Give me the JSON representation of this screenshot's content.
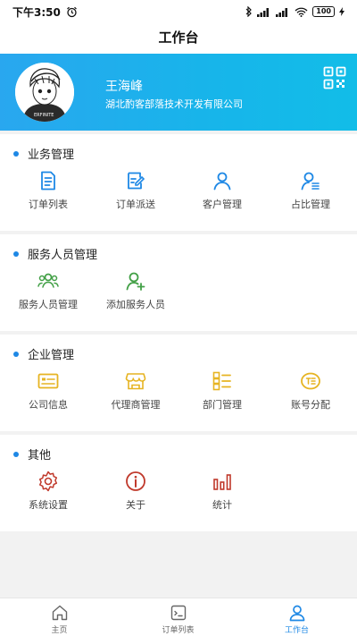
{
  "status": {
    "time": "下午3:50",
    "battery": "100"
  },
  "header": {
    "title": "工作台"
  },
  "profile": {
    "name": "王海峰",
    "company": "湖北酌客部落技术开发有限公司",
    "avatar_icon": "anime-avatar",
    "qr_icon": "qr-code-icon"
  },
  "sections": [
    {
      "title": "业务管理",
      "items": [
        {
          "label": "订单列表",
          "icon": "order-list-icon"
        },
        {
          "label": "订单派送",
          "icon": "order-dispatch-icon"
        },
        {
          "label": "客户管理",
          "icon": "customer-icon"
        },
        {
          "label": "占比管理",
          "icon": "ratio-icon"
        }
      ]
    },
    {
      "title": "服务人员管理",
      "items": [
        {
          "label": "服务人员管理",
          "icon": "staff-group-icon"
        },
        {
          "label": "添加服务人员",
          "icon": "add-user-icon"
        }
      ]
    },
    {
      "title": "企业管理",
      "items": [
        {
          "label": "公司信息",
          "icon": "company-card-icon"
        },
        {
          "label": "代理商管理",
          "icon": "store-icon"
        },
        {
          "label": "部门管理",
          "icon": "department-icon"
        },
        {
          "label": "账号分配",
          "icon": "account-icon"
        }
      ]
    },
    {
      "title": "其他",
      "items": [
        {
          "label": "系统设置",
          "icon": "gear-icon"
        },
        {
          "label": "关于",
          "icon": "info-icon"
        },
        {
          "label": "统计",
          "icon": "bar-chart-icon"
        }
      ]
    }
  ],
  "tabbar": [
    {
      "label": "主页",
      "icon": "home-icon"
    },
    {
      "label": "订单列表",
      "icon": "order-icon"
    },
    {
      "label": "工作台",
      "icon": "person-icon",
      "active": true
    }
  ],
  "colors": {
    "accent": "#1e88e5",
    "green": "#43a047",
    "yellow": "#e6b422",
    "red": "#c0392b",
    "banner": "#21acec"
  }
}
